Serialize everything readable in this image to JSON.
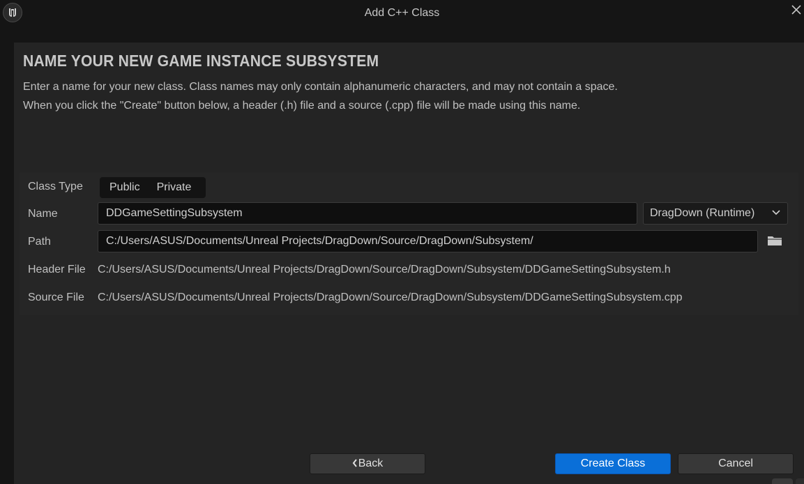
{
  "window": {
    "title": "Add C++ Class",
    "logo_icon": "unreal-engine-logo",
    "close_icon": "close-x"
  },
  "heading": "NAME YOUR NEW GAME INSTANCE SUBSYSTEM",
  "description": {
    "line1": "Enter a name for your new class. Class names may only contain alphanumeric characters, and may not contain a space.",
    "line2": "When you click the \"Create\" button below, a header (.h) file and a source (.cpp) file will be made using this name."
  },
  "form": {
    "class_type": {
      "label": "Class Type",
      "options": [
        "Public",
        "Private"
      ]
    },
    "name": {
      "label": "Name",
      "value": "DDGameSettingSubsystem",
      "module": "DragDown (Runtime)"
    },
    "path": {
      "label": "Path",
      "value": "C:/Users/ASUS/Documents/Unreal Projects/DragDown/Source/DragDown/Subsystem/",
      "browse_icon": "folder-icon"
    },
    "header_file": {
      "label": "Header File",
      "value": "C:/Users/ASUS/Documents/Unreal Projects/DragDown/Source/DragDown/Subsystem/DDGameSettingSubsystem.h"
    },
    "source_file": {
      "label": "Source File",
      "value": "C:/Users/ASUS/Documents/Unreal Projects/DragDown/Source/DragDown/Subsystem/DDGameSettingSubsystem.cpp"
    }
  },
  "buttons": {
    "back": "Back",
    "create": "Create Class",
    "cancel": "Cancel"
  },
  "colors": {
    "accent": "#0a6fd8",
    "background": "#151515",
    "panel": "#242424"
  }
}
